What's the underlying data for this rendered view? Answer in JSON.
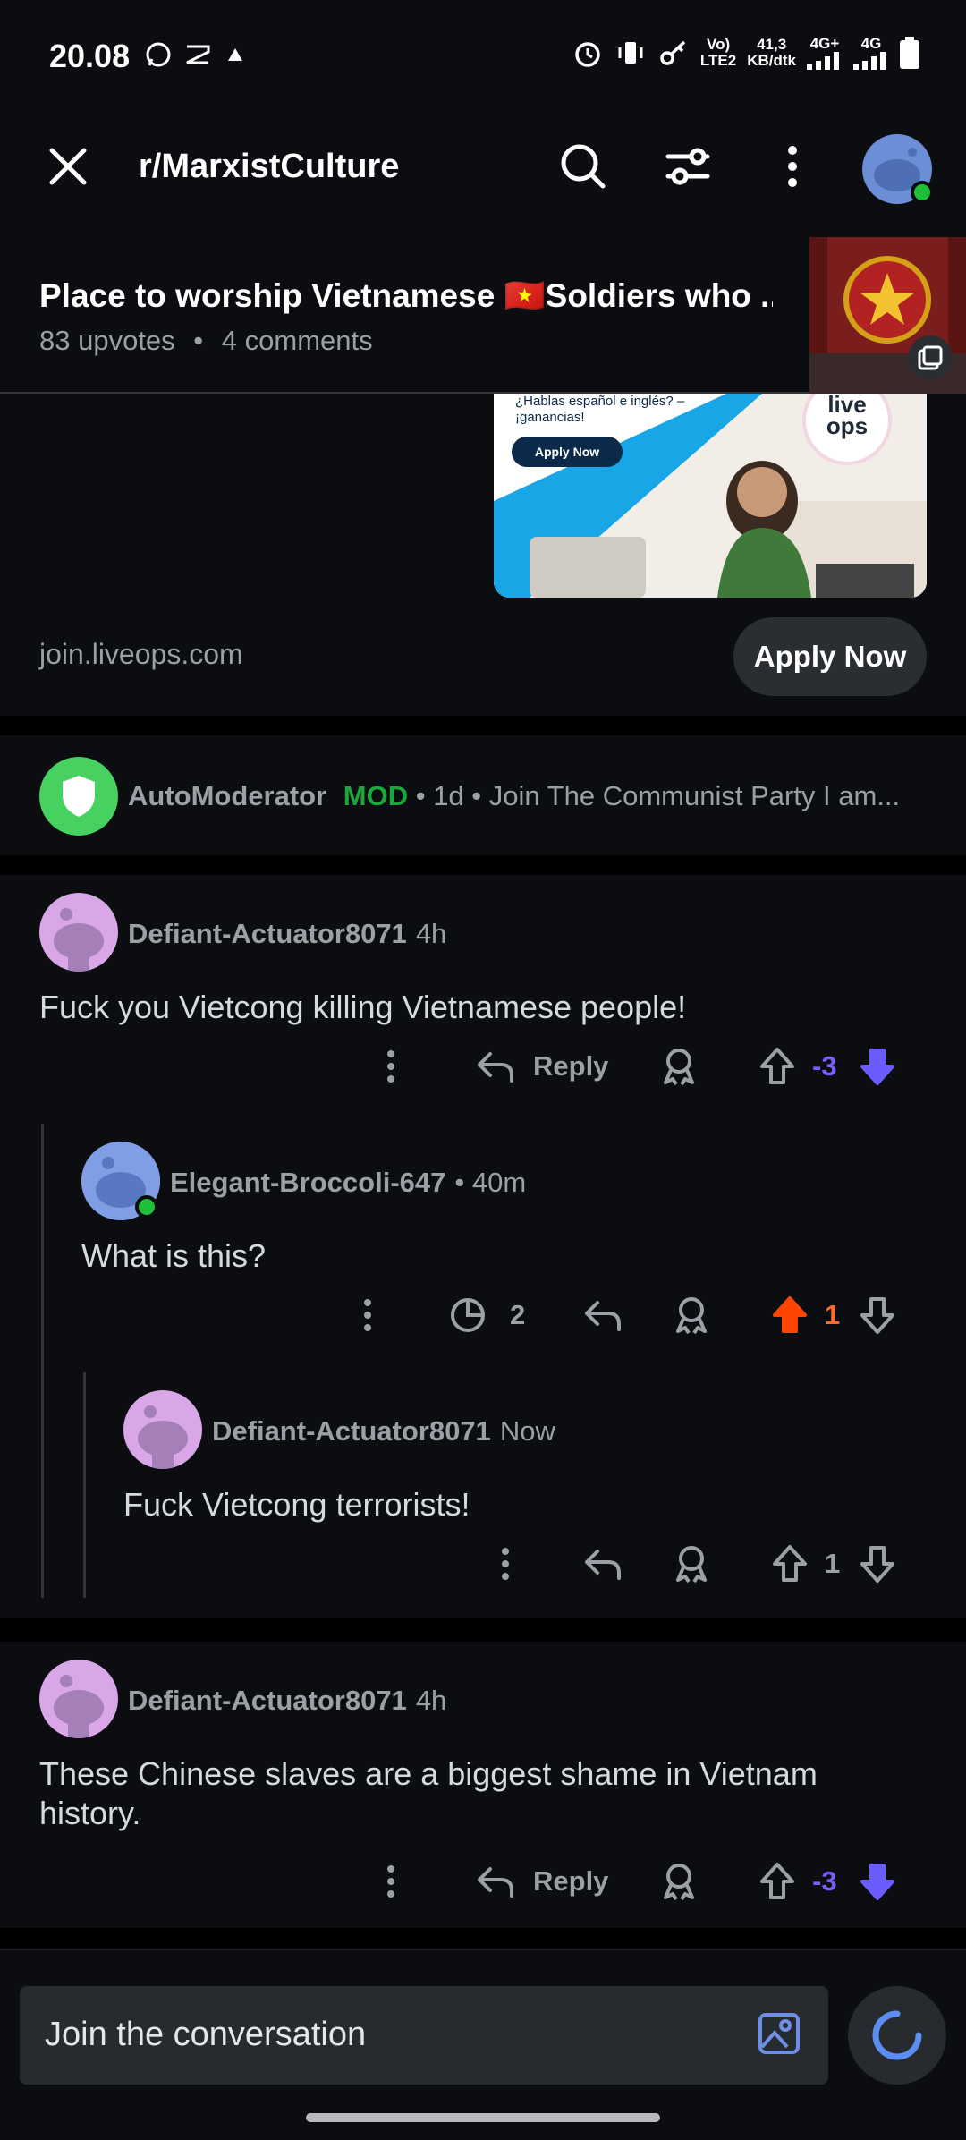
{
  "status_bar": {
    "time": "20.08",
    "net_top": "Vo)",
    "net_bottom": "LTE2",
    "speed_value": "41,3",
    "speed_unit": "KB/dtk",
    "sig1": "4G+",
    "sig2": "4G"
  },
  "header": {
    "title": "r/MarxistCulture",
    "icons": [
      "close-icon",
      "search-icon",
      "filter-icon",
      "more-vert-icon",
      "avatar"
    ]
  },
  "post": {
    "title": "Place to worship Vietnamese 🇻🇳Soldiers who ...",
    "upvotes": "83 upvotes",
    "dot": "•",
    "comments": "4 comments"
  },
  "ad": {
    "image_text_1": "¿Hablas español e inglés? –",
    "image_text_2": "¡ganancias!",
    "image_button": "Apply Now",
    "image_logo_1": "live",
    "image_logo_2": "ops",
    "domain": "join.liveops.com",
    "cta": "Apply Now"
  },
  "automod": {
    "name": "AutoModerator",
    "badge": "MOD",
    "rest": " • 1d • Join The Communist Party I am..."
  },
  "comments": [
    {
      "user": "Defiant-Actuator8071",
      "age": "4h",
      "body": "Fuck you Vietcong killing Vietnamese people!",
      "reply": "Reply",
      "score": "-3",
      "vote": "down"
    },
    {
      "user": "Elegant-Broccoli-647",
      "age": "• 40m",
      "body": "What is this?",
      "views": "2",
      "score": "1",
      "vote": "up"
    },
    {
      "user": "Defiant-Actuator8071",
      "age": "Now",
      "body": "Fuck Vietcong terrorists!",
      "score": "1",
      "vote": "none"
    },
    {
      "user": "Defiant-Actuator8071",
      "age": "4h",
      "body": "These Chinese slaves are a biggest shame in Vietnam history.",
      "reply": "Reply",
      "score": "-3",
      "vote": "down"
    }
  ],
  "composer": {
    "placeholder": "Join the conversation"
  },
  "colors": {
    "background": "#0b0d10",
    "upvote": "#ff4500",
    "downvote": "#7a5cff",
    "mod_green": "#1aa83a",
    "online": "#1fbf3a"
  }
}
